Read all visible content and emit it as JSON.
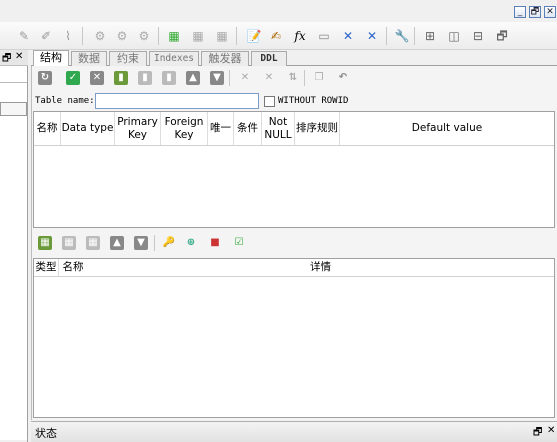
{
  "window_controls": {
    "minimize": "_",
    "restore": "🗗",
    "close": "✕"
  },
  "left_panel": {
    "pin": "🗗",
    "close": "✕"
  },
  "tabs": [
    {
      "label": "结构",
      "active": true
    },
    {
      "label": "数据",
      "active": false
    },
    {
      "label": "约束",
      "active": false
    },
    {
      "label": "Indexes",
      "active": false
    },
    {
      "label": "触发器",
      "active": false
    },
    {
      "label": "DDL",
      "active": false
    }
  ],
  "form": {
    "table_name_label": "Table name:",
    "table_name_value": "",
    "without_rowid_label": "WITHOUT ROWID",
    "without_rowid_checked": false
  },
  "columns_grid": {
    "headers": [
      "名称",
      "Data type",
      "Primary\nKey",
      "Foreign\nKey",
      "唯一",
      "条件",
      "Not\nNULL",
      "排序规则",
      "Default value"
    ],
    "rows": []
  },
  "constraints_grid": {
    "headers": [
      "类型",
      "名称",
      "详情"
    ],
    "rows": []
  },
  "status": {
    "label": "状态",
    "pin": "🗗",
    "close": "✕"
  },
  "accent_colors": {
    "tab_border": "#a9a9a9",
    "green": "#2fa84f",
    "blue": "#3f71c6",
    "input_border": "#7a9cc6"
  }
}
